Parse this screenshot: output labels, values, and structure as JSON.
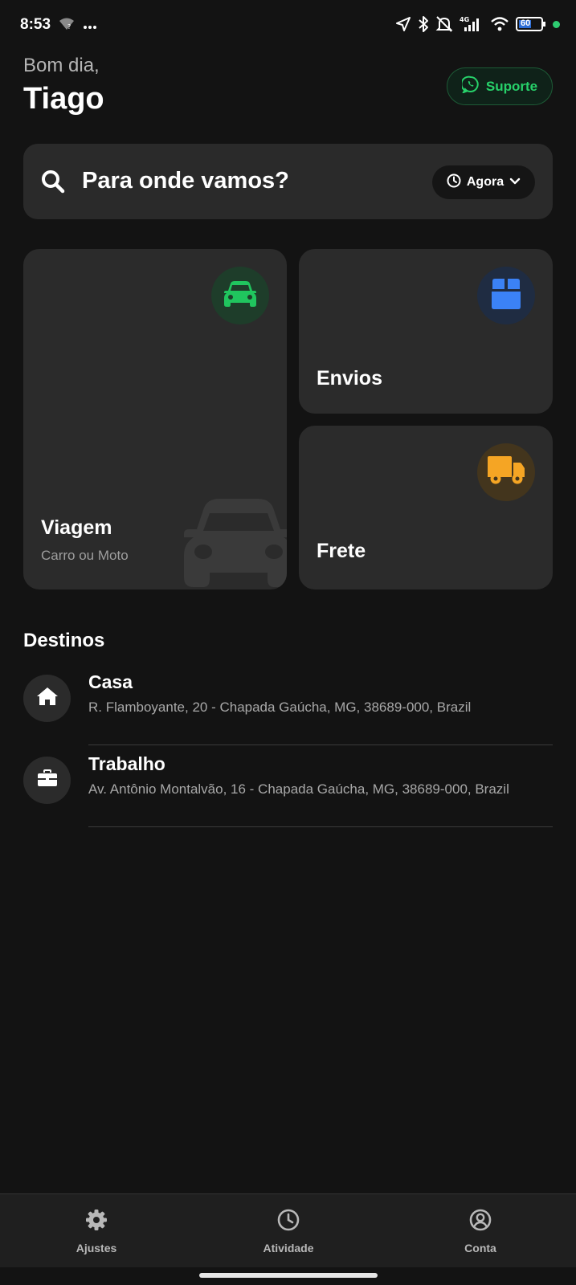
{
  "status_bar": {
    "time": "8:53",
    "network_label": "4G",
    "battery_level": "60",
    "left_icons": [
      "wifi-question-icon",
      "more-dots-icon"
    ],
    "right_icons": [
      "location-arrow-icon",
      "bluetooth-icon",
      "muted-bell-icon",
      "signal-icon",
      "wifi-icon",
      "battery-icon"
    ]
  },
  "header": {
    "greeting": "Bom dia,",
    "user_name": "Tiago",
    "support_label": "Suporte",
    "support_icon": "whatsapp-icon"
  },
  "search": {
    "placeholder": "Para onde vamos?",
    "time_option": "Agora",
    "icon": "search-icon"
  },
  "services": [
    {
      "title": "Viagem",
      "subtitle": "Carro ou Moto",
      "icon": "car-icon",
      "accent": "#20c55e",
      "icon_bg": "#1e3d2a"
    },
    {
      "title": "Envios",
      "icon": "box-icon",
      "accent": "#3b82f6",
      "icon_bg": "#1f2c42"
    },
    {
      "title": "Frete",
      "icon": "truck-icon",
      "accent": "#f5a524",
      "icon_bg": "#43351d"
    }
  ],
  "destinations": {
    "title": "Destinos",
    "items": [
      {
        "name": "Casa",
        "address": "R. Flamboyante, 20 - Chapada Gaúcha, MG, 38689-000, Brazil",
        "icon": "home-icon"
      },
      {
        "name": "Trabalho",
        "address": "Av. Antônio Montalvão, 16 - Chapada Gaúcha, MG, 38689-000, Brazil",
        "icon": "briefcase-icon"
      }
    ]
  },
  "bottom_nav": [
    {
      "label": "Ajustes",
      "icon": "gear-icon"
    },
    {
      "label": "Atividade",
      "icon": "clock-icon"
    },
    {
      "label": "Conta",
      "icon": "user-circle-icon"
    }
  ],
  "colors": {
    "background": "#131313",
    "card": "#2b2b2b",
    "brand_green": "#27d16a"
  }
}
